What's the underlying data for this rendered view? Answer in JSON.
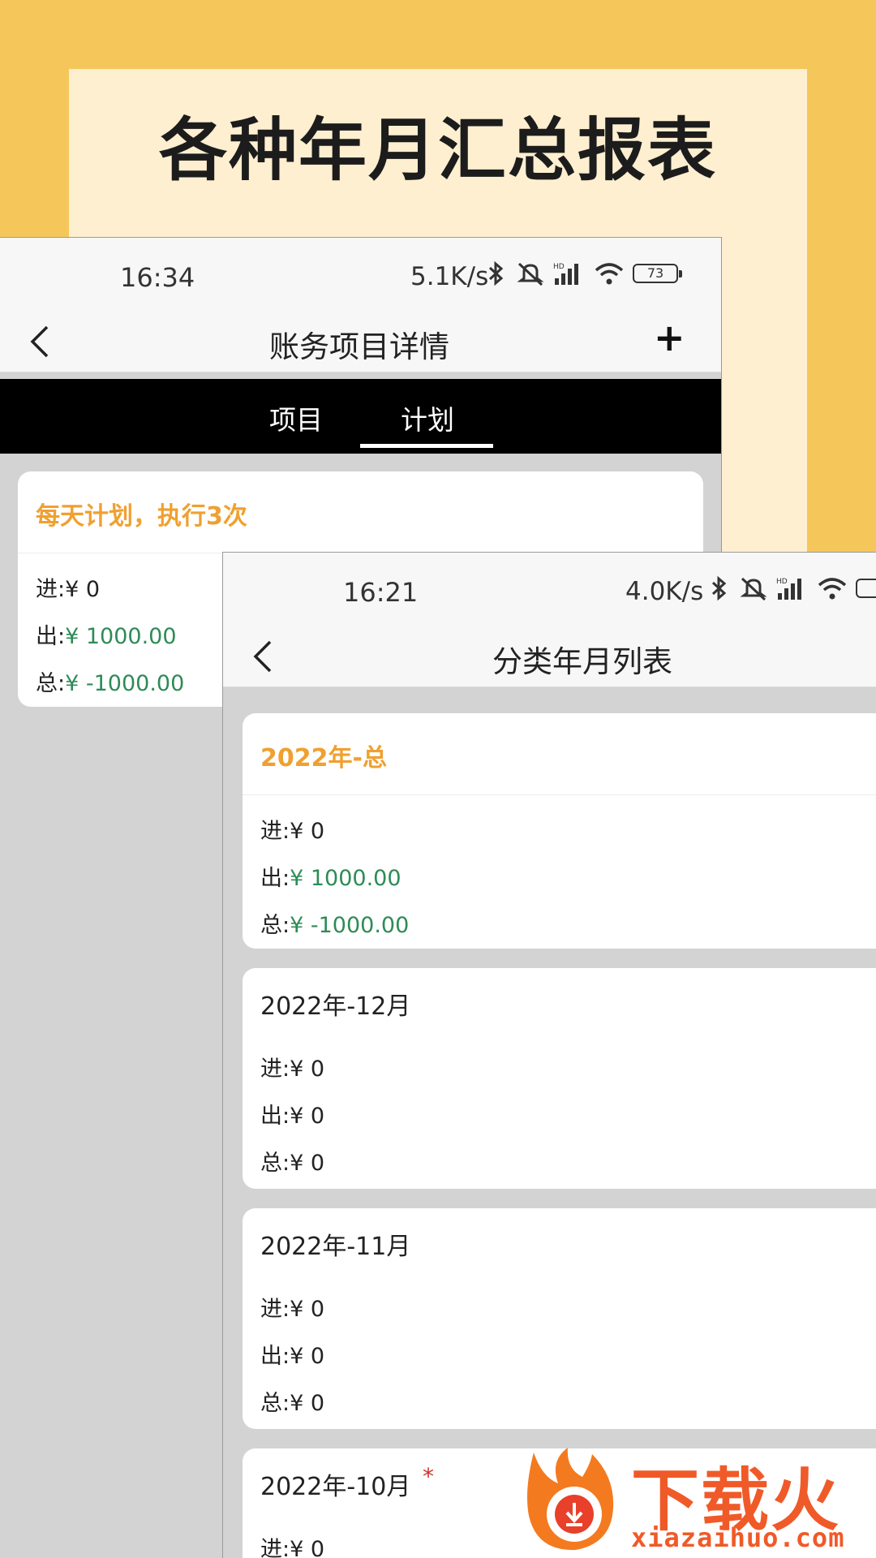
{
  "headline": "各种年月汇总报表",
  "screen1": {
    "status": {
      "time": "16:34",
      "net": "5.1K/s",
      "battery": "73"
    },
    "nav": {
      "title": "账务项目详情",
      "plus": "+"
    },
    "tabs": [
      {
        "label": "项目",
        "active": false
      },
      {
        "label": "计划",
        "active": true
      }
    ],
    "plan_card": {
      "title": "每天计划，执行3次",
      "rows": [
        {
          "label": "进:",
          "value": "¥ 0",
          "color": "default"
        },
        {
          "label": "出:",
          "value": "¥ 1000.00",
          "color": "#2e8b57"
        },
        {
          "label": "总:",
          "value": "¥ -1000.00",
          "color": "#2e8b57"
        }
      ]
    }
  },
  "screen2": {
    "status": {
      "time": "16:21",
      "net": "4.0K/s"
    },
    "nav": {
      "title": "分类年月列表"
    },
    "cards": [
      {
        "title": "2022年-总",
        "rows": [
          {
            "label": "进:",
            "value": "¥ 0"
          },
          {
            "label": "出:",
            "value": "¥ 1000.00"
          },
          {
            "label": "总:",
            "value": "¥ -1000.00"
          }
        ]
      },
      {
        "title": "2022年-12月",
        "rows": [
          {
            "label": "进:",
            "value": "¥ 0"
          },
          {
            "label": "出:",
            "value": "¥ 0"
          },
          {
            "label": "总:",
            "value": "¥ 0"
          }
        ]
      },
      {
        "title": "2022年-11月",
        "rows": [
          {
            "label": "进:",
            "value": "¥ 0"
          },
          {
            "label": "出:",
            "value": "¥ 0"
          },
          {
            "label": "总:",
            "value": "¥ 0"
          }
        ]
      },
      {
        "title": "2022年-10月",
        "star": "*",
        "rows": [
          {
            "label": "进:",
            "value": "¥ 0"
          }
        ]
      }
    ]
  },
  "watermark": {
    "text": "下载火",
    "url": "xiazaihuo.com"
  },
  "colors": {
    "accent_orange": "#f0a030",
    "money_green": "#2e8b57",
    "background": "#f5c65a"
  }
}
